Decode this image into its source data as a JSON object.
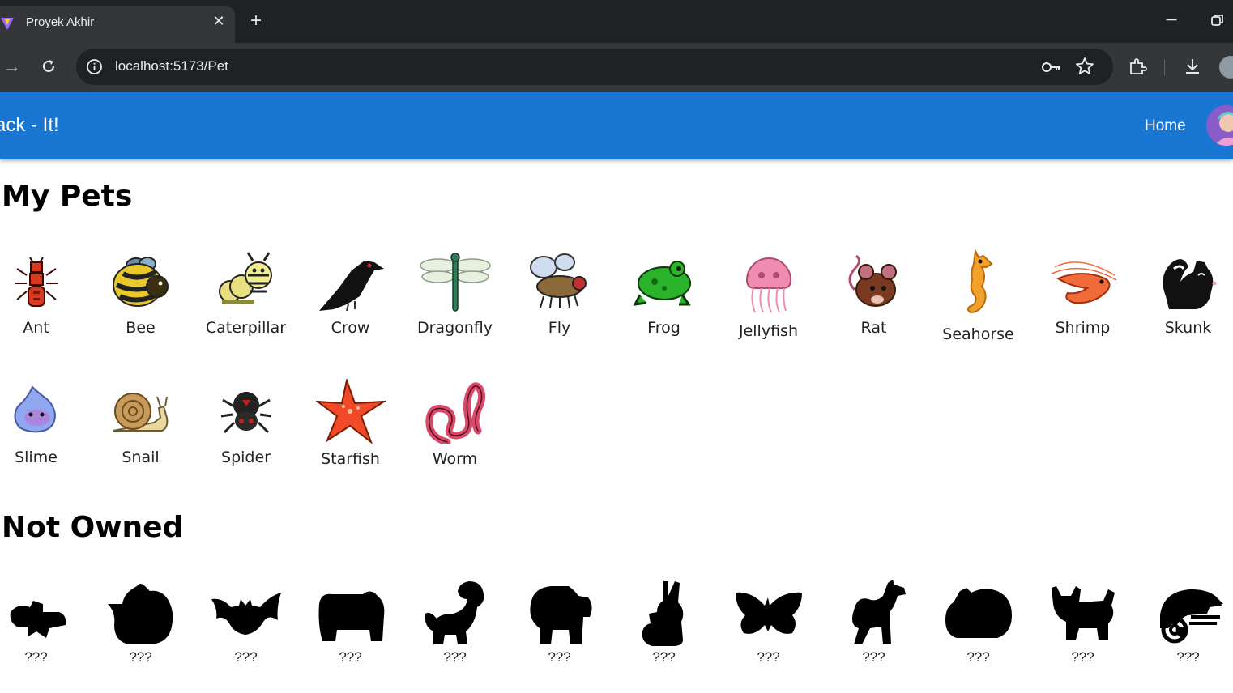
{
  "browser": {
    "tab_title": "Proyek Akhir",
    "url": "localhost:5173/Pet"
  },
  "header": {
    "brand": "ack - It!",
    "home": "Home"
  },
  "my_pets": {
    "title": "My Pets",
    "items": [
      {
        "name": "Ant",
        "icon": "ant-icon",
        "color": "#d93a1f"
      },
      {
        "name": "Bee",
        "icon": "bee-icon",
        "color": "#e8c82a"
      },
      {
        "name": "Caterpillar",
        "icon": "caterpillar-icon",
        "color": "#e8e080"
      },
      {
        "name": "Crow",
        "icon": "crow-icon",
        "color": "#111111"
      },
      {
        "name": "Dragonfly",
        "icon": "dragonfly-icon",
        "color": "#2f7d5a"
      },
      {
        "name": "Fly",
        "icon": "fly-icon",
        "color": "#8a6a3a"
      },
      {
        "name": "Frog",
        "icon": "frog-icon",
        "color": "#2bb32b"
      },
      {
        "name": "Jellyfish",
        "icon": "jellyfish-icon",
        "color": "#f08cb0"
      },
      {
        "name": "Rat",
        "icon": "rat-icon",
        "color": "#7a3a22"
      },
      {
        "name": "Seahorse",
        "icon": "seahorse-icon",
        "color": "#f2a22a"
      },
      {
        "name": "Shrimp",
        "icon": "shrimp-icon",
        "color": "#f06a3a"
      },
      {
        "name": "Skunk",
        "icon": "skunk-icon",
        "color": "#111111"
      },
      {
        "name": "Slime",
        "icon": "slime-icon",
        "color": "#8fa8f0"
      },
      {
        "name": "Snail",
        "icon": "snail-icon",
        "color": "#c89a5a"
      },
      {
        "name": "Spider",
        "icon": "spider-icon",
        "color": "#222222"
      },
      {
        "name": "Starfish",
        "icon": "starfish-icon",
        "color": "#f04a2a"
      },
      {
        "name": "Worm",
        "icon": "worm-icon",
        "color": "#d84a6a"
      }
    ]
  },
  "not_owned": {
    "title": "Not Owned",
    "items": [
      {
        "name": "???",
        "icon": "crocodile-silhouette-icon"
      },
      {
        "name": "???",
        "icon": "pig-silhouette-icon"
      },
      {
        "name": "???",
        "icon": "bat-silhouette-icon"
      },
      {
        "name": "???",
        "icon": "bear-silhouette-icon"
      },
      {
        "name": "???",
        "icon": "dinosaur-silhouette-icon"
      },
      {
        "name": "???",
        "icon": "buffalo-silhouette-icon"
      },
      {
        "name": "???",
        "icon": "bunny-silhouette-icon"
      },
      {
        "name": "???",
        "icon": "butterfly-silhouette-icon"
      },
      {
        "name": "???",
        "icon": "camel-silhouette-icon"
      },
      {
        "name": "???",
        "icon": "hamster-silhouette-icon"
      },
      {
        "name": "???",
        "icon": "cat-silhouette-icon"
      },
      {
        "name": "???",
        "icon": "chameleon-silhouette-icon"
      }
    ]
  }
}
